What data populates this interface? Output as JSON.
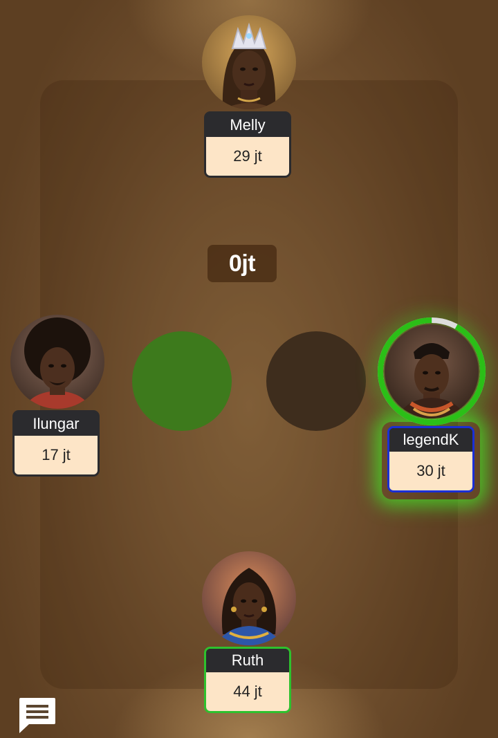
{
  "pot": {
    "amount": "0jt"
  },
  "players": {
    "top": {
      "name": "Melly",
      "chips": "29 jt"
    },
    "left": {
      "name": "Ilungar",
      "chips": "17 jt"
    },
    "right": {
      "name": "legendK",
      "chips": "30 jt",
      "turn_timer_fraction": 0.92
    },
    "bottom": {
      "name": "Ruth",
      "chips": "44 jt"
    }
  },
  "colors": {
    "seat_empty_green": "#3d7a1c",
    "seat_empty_dark": "#3e2d1d",
    "active_turn_ring": "#2bbf17",
    "highlight_blue": "#1a2fd6",
    "highlight_green": "#2ec12e"
  },
  "icons": {
    "chat": "chat-bubble-icon"
  }
}
